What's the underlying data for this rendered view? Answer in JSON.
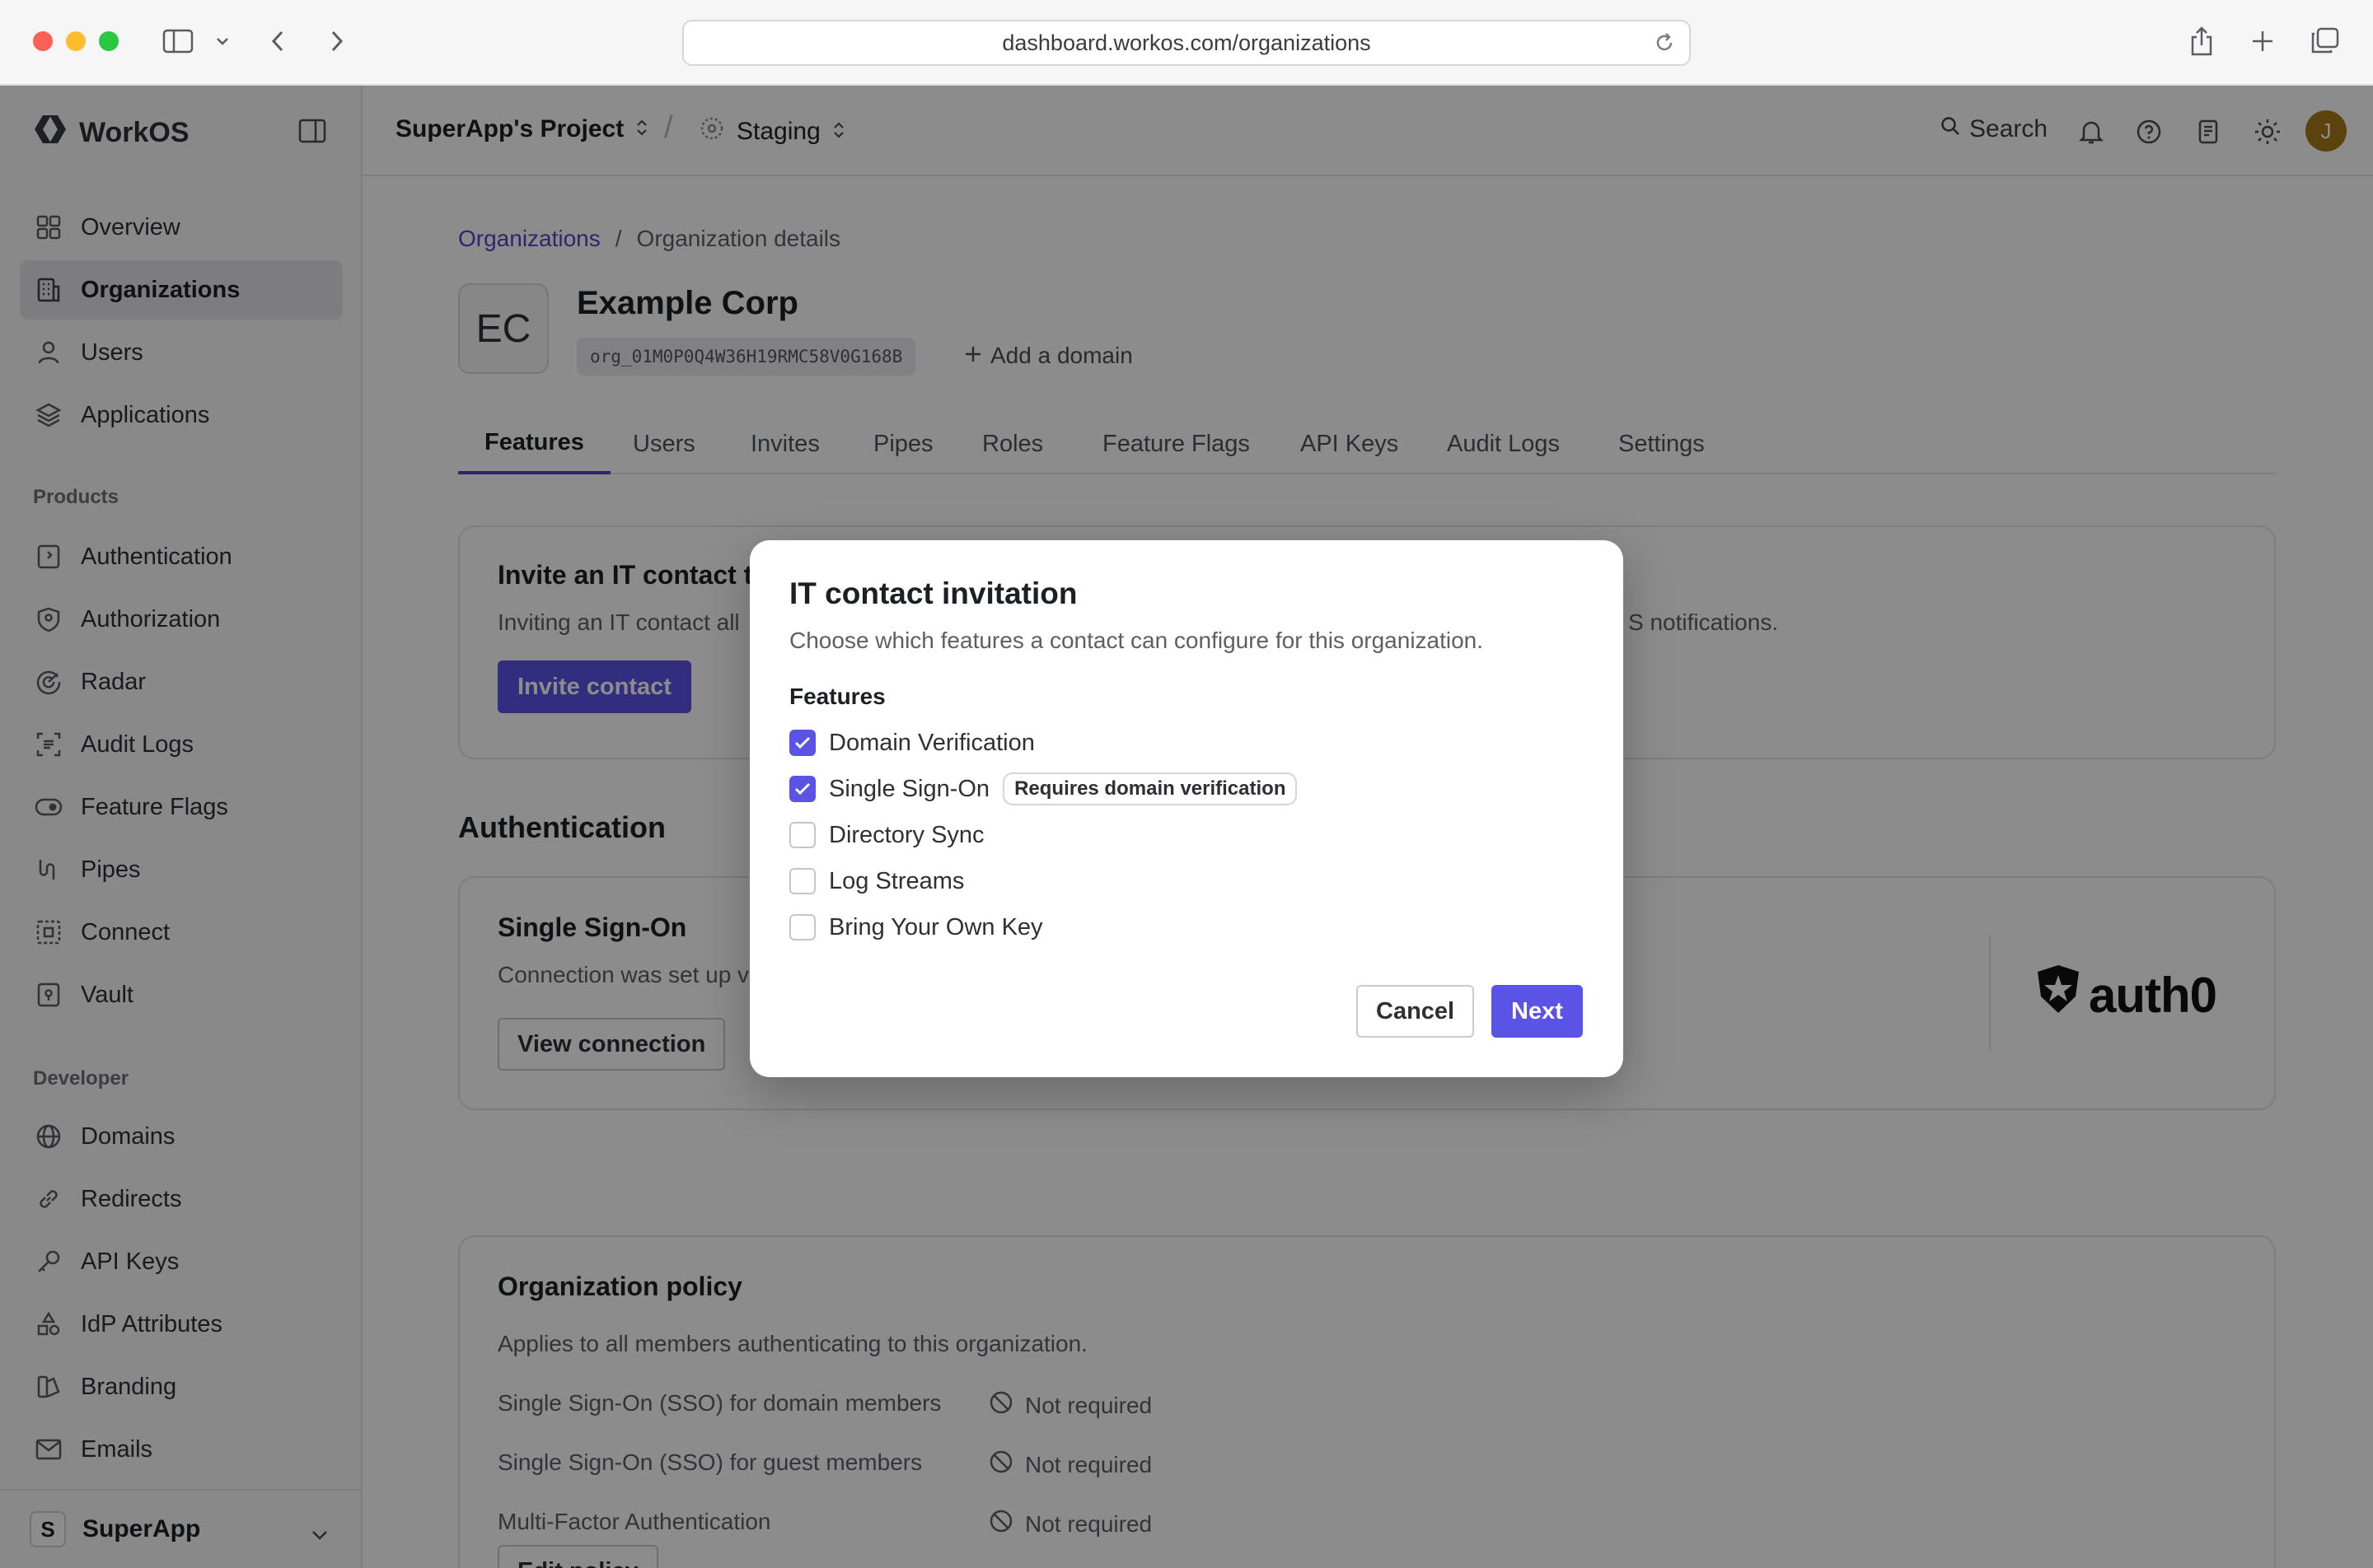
{
  "browser": {
    "url": "dashboard.workos.com/organizations"
  },
  "sidebar": {
    "brand": "WorkOS",
    "items": [
      {
        "label": "Overview"
      },
      {
        "label": "Organizations"
      },
      {
        "label": "Users"
      },
      {
        "label": "Applications"
      }
    ],
    "products_heading": "Products",
    "products": [
      {
        "label": "Authentication"
      },
      {
        "label": "Authorization"
      },
      {
        "label": "Radar"
      },
      {
        "label": "Audit Logs"
      },
      {
        "label": "Feature Flags"
      },
      {
        "label": "Pipes"
      },
      {
        "label": "Connect"
      },
      {
        "label": "Vault"
      }
    ],
    "developer_heading": "Developer",
    "developer": [
      {
        "label": "Domains"
      },
      {
        "label": "Redirects"
      },
      {
        "label": "API Keys"
      },
      {
        "label": "IdP Attributes"
      },
      {
        "label": "Branding"
      },
      {
        "label": "Emails"
      }
    ],
    "workspace": {
      "badge": "S",
      "name": "SuperApp"
    }
  },
  "topbar": {
    "project": "SuperApp's Project",
    "environment": "Staging",
    "search": "Search",
    "avatar_initial": "J"
  },
  "breadcrumb": {
    "parent": "Organizations",
    "separator": "/",
    "current": "Organization details"
  },
  "org": {
    "initials": "EC",
    "name": "Example Corp",
    "id": "org_01M0P0Q4W36H19RMC58V0G168B",
    "add_domain": "Add a domain"
  },
  "tabs": [
    "Features",
    "Users",
    "Invites",
    "Pipes",
    "Roles",
    "Feature Flags",
    "API Keys",
    "Audit Logs",
    "Settings"
  ],
  "invite_card": {
    "title": "Invite an IT contact t",
    "text_left": "Inviting an IT contact all",
    "text_right": "S notifications.",
    "button": "Invite contact"
  },
  "auth_section": {
    "heading": "Authentication",
    "sso_title": "Single Sign-On",
    "sso_text": "Connection was set up v",
    "view_button": "View connection",
    "provider_logo": "auth0"
  },
  "policy": {
    "title": "Organization policy",
    "description": "Applies to all members authenticating to this organization.",
    "rows": [
      {
        "label": "Single Sign-On (SSO) for domain members",
        "value": "Not required"
      },
      {
        "label": "Single Sign-On (SSO) for guest members",
        "value": "Not required"
      },
      {
        "label": "Multi-Factor Authentication",
        "value": "Not required"
      }
    ],
    "edit_button": "Edit policy"
  },
  "modal": {
    "title": "IT contact invitation",
    "description": "Choose which features a contact can configure for this organization.",
    "features_label": "Features",
    "options": [
      {
        "label": "Domain Verification",
        "checked": true
      },
      {
        "label": "Single Sign-On",
        "checked": true,
        "badge": "Requires domain verification"
      },
      {
        "label": "Directory Sync",
        "checked": false
      },
      {
        "label": "Log Streams",
        "checked": false
      },
      {
        "label": "Bring Your Own Key",
        "checked": false
      }
    ],
    "cancel": "Cancel",
    "next": "Next"
  },
  "colors": {
    "accent": "#5b52e6",
    "link": "#4f46c8",
    "overlay": "rgba(0,0,0,0.45)"
  }
}
